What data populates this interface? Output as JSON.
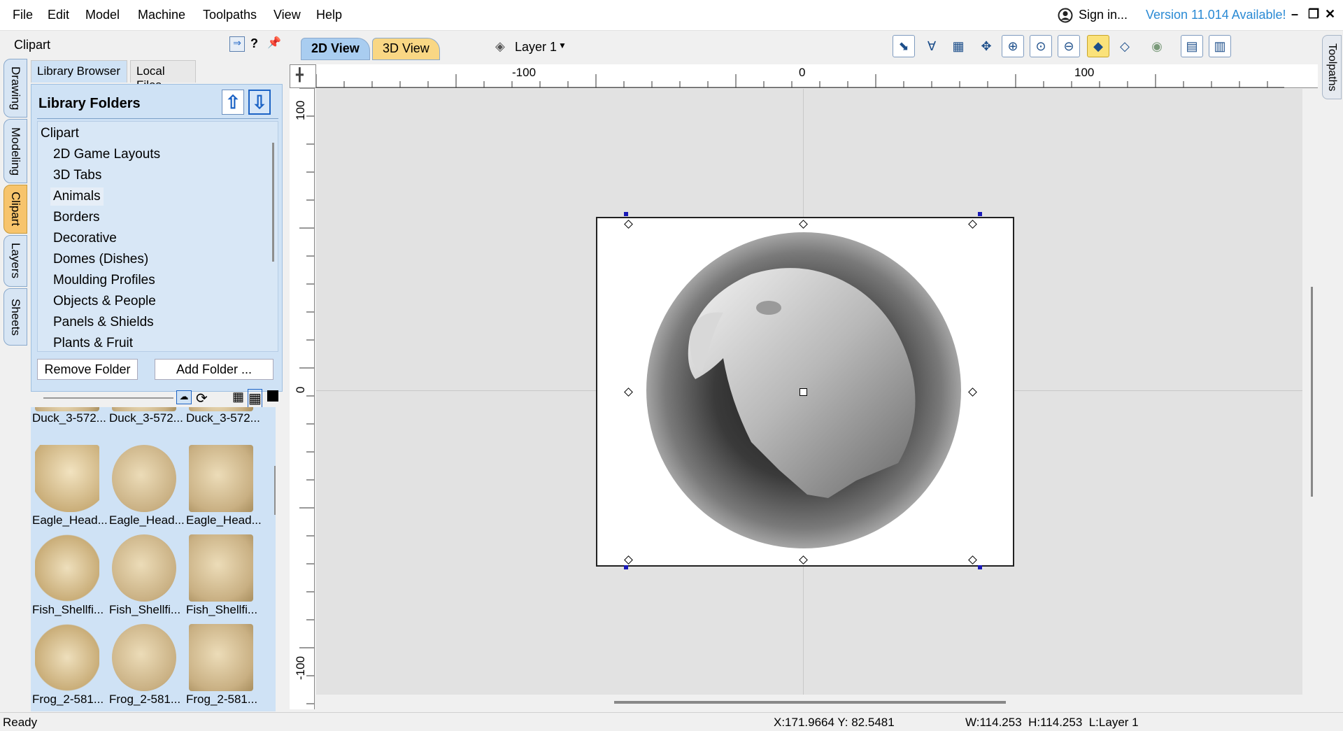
{
  "menu": {
    "items": [
      "File",
      "Edit",
      "Model",
      "Machine",
      "Toolpaths",
      "View",
      "Help"
    ],
    "signin": "Sign in...",
    "version": "Version 11.014 Available!"
  },
  "panel": {
    "title": "Clipart",
    "help": "?",
    "vtabs": [
      "Drawing",
      "Modeling",
      "Clipart",
      "Layers",
      "Sheets"
    ],
    "libtabs": [
      "Library Browser",
      "Local Files"
    ]
  },
  "library": {
    "title": "Library Folders",
    "folders": [
      "Clipart",
      "2D Game Layouts",
      "3D Tabs",
      "Animals",
      "Borders",
      "Decorative",
      "Domes (Dishes)",
      "Moulding Profiles",
      "Objects & People",
      "Panels & Shields",
      "Plants & Fruit"
    ],
    "selected": "Animals",
    "remove_label": "Remove Folder",
    "add_label": "Add Folder ..."
  },
  "thumbnails": [
    {
      "label": "Duck_3-572..."
    },
    {
      "label": "Duck_3-572..."
    },
    {
      "label": "Duck_3-572..."
    },
    {
      "label": "Eagle_Head..."
    },
    {
      "label": "Eagle_Head..."
    },
    {
      "label": "Eagle_Head..."
    },
    {
      "label": "Fish_Shellfi..."
    },
    {
      "label": "Fish_Shellfi..."
    },
    {
      "label": "Fish_Shellfi..."
    },
    {
      "label": "Frog_2-581..."
    },
    {
      "label": "Frog_2-581..."
    },
    {
      "label": "Frog_2-581..."
    }
  ],
  "view": {
    "tab2d": "2D View",
    "tab3d": "3D View",
    "layer": "Layer 1",
    "right_tab": "Toolpaths"
  },
  "ruler": {
    "h_labels": [
      "-100",
      "0",
      "100"
    ],
    "v_labels": [
      "100",
      "0",
      "-100"
    ]
  },
  "status": {
    "ready": "Ready",
    "coords": "X:171.9664 Y: 82.5481",
    "dims": "W:114.253  H:114.253  L:Layer 1"
  },
  "colors": {
    "accent": "#2a8ad4",
    "panel_blue": "#cfe2f5",
    "canvas_bg": "#e2e2e2"
  }
}
